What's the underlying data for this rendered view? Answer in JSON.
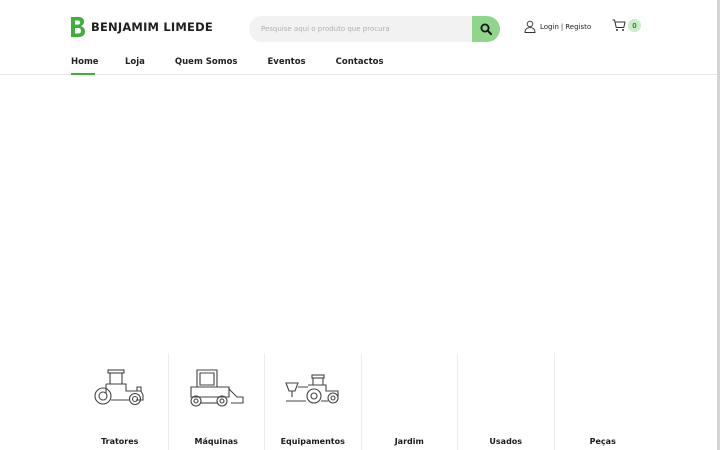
{
  "brand": {
    "name": "BENJAMIM LIMEDE",
    "accent_color": "#3fae3c"
  },
  "search": {
    "placeholder": "Pesquise aqui o produto que procura",
    "button_icon": "search-icon"
  },
  "account": {
    "login_label": "Login",
    "separator": "|",
    "register_label": "Registo",
    "icon": "user-icon"
  },
  "cart": {
    "icon": "cart-icon",
    "count": "0"
  },
  "nav": {
    "items": [
      {
        "label": "Home",
        "active": true
      },
      {
        "label": "Loja"
      },
      {
        "label": "Quem Somos"
      },
      {
        "label": "Eventos"
      },
      {
        "label": "Contactos"
      }
    ]
  },
  "categories": [
    {
      "label": "Tratores",
      "icon": "tractor-icon"
    },
    {
      "label": "Máquinas",
      "icon": "loader-machine-icon"
    },
    {
      "label": "Equipamentos",
      "icon": "tractor-spreader-icon"
    },
    {
      "label": "Jardim",
      "icon": ""
    },
    {
      "label": "Usados",
      "icon": ""
    },
    {
      "label": "Peças",
      "icon": ""
    }
  ]
}
